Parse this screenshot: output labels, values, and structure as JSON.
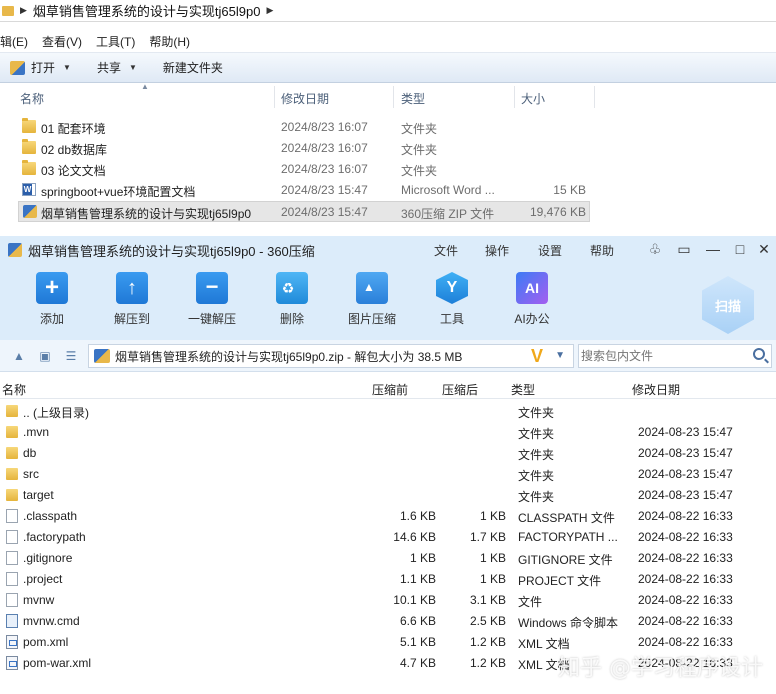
{
  "explorer": {
    "breadcrumb": "烟草销售管理系统的设计与实现tj65l9p0",
    "menu": [
      "辑(E)",
      "查看(V)",
      "工具(T)",
      "帮助(H)"
    ],
    "toolbar": {
      "open": "打开",
      "share": "共享",
      "new_folder": "新建文件夹"
    },
    "columns": {
      "name": "名称",
      "date": "修改日期",
      "type": "类型",
      "size": "大小"
    },
    "rows": [
      {
        "name": "01 配套环境",
        "date": "2024/8/23 16:07",
        "type": "文件夹",
        "size": "",
        "icon": "folder-icon"
      },
      {
        "name": "02 db数据库",
        "date": "2024/8/23 16:07",
        "type": "文件夹",
        "size": "",
        "icon": "folder-icon"
      },
      {
        "name": "03 论文文档",
        "date": "2024/8/23 16:07",
        "type": "文件夹",
        "size": "",
        "icon": "folder-icon"
      },
      {
        "name": "springboot+vue环境配置文档",
        "date": "2024/8/23 15:47",
        "type": "Microsoft Word ...",
        "size": "15 KB",
        "icon": "word-icon"
      },
      {
        "name": "烟草销售管理系统的设计与实现tj65l9p0",
        "date": "2024/8/23 15:47",
        "type": "360压缩 ZIP 文件",
        "size": "19,476 KB",
        "icon": "zip-icon",
        "selected": true
      }
    ]
  },
  "zip": {
    "title": "烟草销售管理系统的设计与实现tj65l9p0 - 360压缩",
    "menu": {
      "file": "文件",
      "action": "操作",
      "settings": "设置",
      "help": "帮助"
    },
    "tools": {
      "add": "添加",
      "extract_to": "解压到",
      "one_click": "一键解压",
      "delete": "删除",
      "image": "图片压缩",
      "tools": "工具",
      "ai": "AI办公"
    },
    "scan": "扫描",
    "path": "烟草销售管理系统的设计与实现tj65l9p0.zip - 解包大小为 38.5 MB",
    "search_placeholder": "搜索包内文件",
    "columns": {
      "name": "名称",
      "compressed": "压缩前",
      "after": "压缩后",
      "type": "类型",
      "modified": "修改日期"
    },
    "rows": [
      {
        "name": ".. (上级目录)",
        "before": "",
        "after": "",
        "type": "文件夹",
        "date": "",
        "icon": "folder-icon"
      },
      {
        "name": ".mvn",
        "before": "",
        "after": "",
        "type": "文件夹",
        "date": "2024-08-23 15:47",
        "icon": "folder-icon"
      },
      {
        "name": "db",
        "before": "",
        "after": "",
        "type": "文件夹",
        "date": "2024-08-23 15:47",
        "icon": "folder-icon"
      },
      {
        "name": "src",
        "before": "",
        "after": "",
        "type": "文件夹",
        "date": "2024-08-23 15:47",
        "icon": "folder-icon"
      },
      {
        "name": "target",
        "before": "",
        "after": "",
        "type": "文件夹",
        "date": "2024-08-23 15:47",
        "icon": "folder-icon"
      },
      {
        "name": ".classpath",
        "before": "1.6 KB",
        "after": "1 KB",
        "type": "CLASSPATH 文件",
        "date": "2024-08-22 16:33",
        "icon": "file-icon"
      },
      {
        "name": ".factorypath",
        "before": "14.6 KB",
        "after": "1.7 KB",
        "type": "FACTORYPATH ...",
        "date": "2024-08-22 16:33",
        "icon": "file-icon"
      },
      {
        "name": ".gitignore",
        "before": "1 KB",
        "after": "1 KB",
        "type": "GITIGNORE 文件",
        "date": "2024-08-22 16:33",
        "icon": "file-icon"
      },
      {
        "name": ".project",
        "before": "1.1 KB",
        "after": "1 KB",
        "type": "PROJECT 文件",
        "date": "2024-08-22 16:33",
        "icon": "file-icon"
      },
      {
        "name": "mvnw",
        "before": "10.1 KB",
        "after": "3.1 KB",
        "type": "文件",
        "date": "2024-08-22 16:33",
        "icon": "file-icon"
      },
      {
        "name": "mvnw.cmd",
        "before": "6.6 KB",
        "after": "2.5 KB",
        "type": "Windows 命令脚本",
        "date": "2024-08-22 16:33",
        "icon": "cmd-icon"
      },
      {
        "name": "pom.xml",
        "before": "5.1 KB",
        "after": "1.2 KB",
        "type": "XML 文档",
        "date": "2024-08-22 16:33",
        "icon": "xml-icon"
      },
      {
        "name": "pom-war.xml",
        "before": "4.7 KB",
        "after": "1.2 KB",
        "type": "XML 文档",
        "date": "2024-08-22 16:33",
        "icon": "xml-icon"
      }
    ]
  },
  "watermark": "知乎 @学习程序设计"
}
